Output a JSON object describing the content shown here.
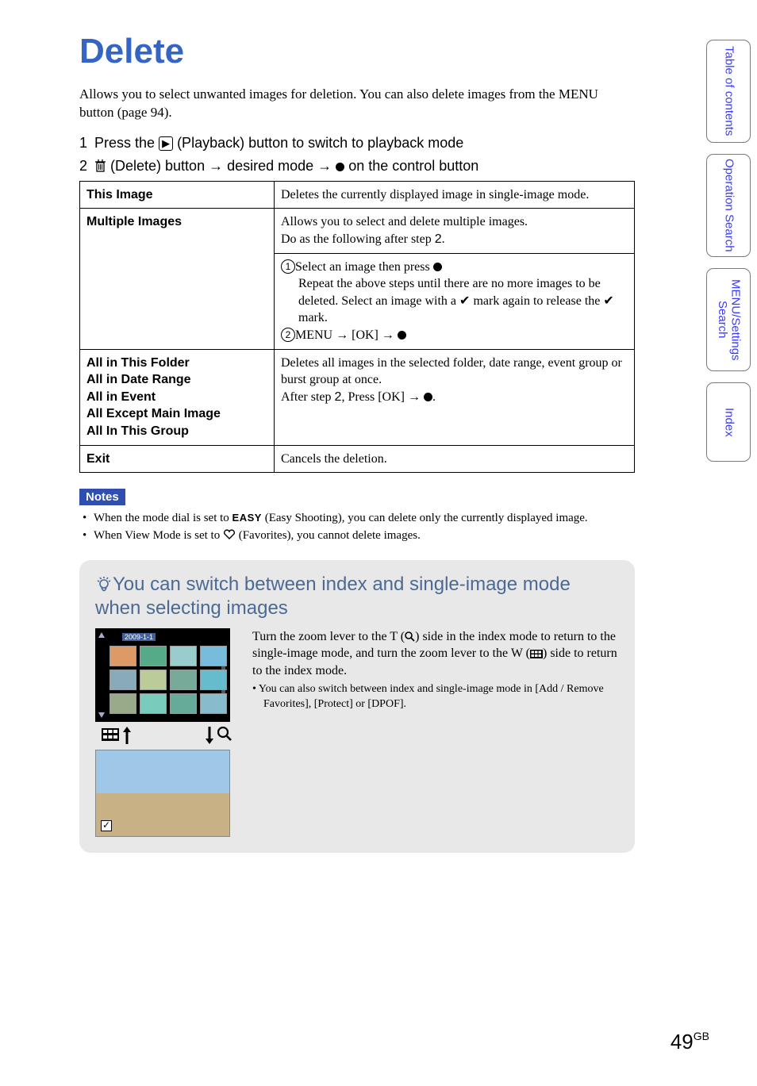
{
  "title": "Delete",
  "intro": "Allows you to select unwanted images for deletion. You can also delete images from the MENU button (page 94).",
  "step1": {
    "num": "1",
    "prefix": "Press the ",
    "suffix": " (Playback) button to switch to playback mode"
  },
  "step2": {
    "num": "2",
    "a": " (Delete) button ",
    "b": " desired mode ",
    "c": " on the control button"
  },
  "table": {
    "r1k": "This Image",
    "r1v": "Deletes the currently displayed image in single-image mode.",
    "r2k": "Multiple Images",
    "r2va": "Allows you to select and delete multiple images.",
    "r2vb_prefix": "Do as the following after step ",
    "r2vb_step": "2",
    "r2vb_suffix": ".",
    "r2s1a": "Select an image then press ",
    "r2s1b": "Repeat the above steps until there are no more images to be deleted. Select an image with a ",
    "r2s1c": " mark again to release the ",
    "r2s1d": " mark.",
    "r2s2a": "MENU ",
    "r2s2b": " [OK] ",
    "r3k1": "All in This Folder",
    "r3k2": "All in Date Range",
    "r3k3": "All in Event",
    "r3k4": "All Except Main Image",
    "r3k5": "All In This Group",
    "r3va": "Deletes all images in the selected folder, date range, event group or burst group at once.",
    "r3vb_prefix": "After step ",
    "r3vb_step": "2",
    "r3vb_mid": ", Press [OK] ",
    "r4k": "Exit",
    "r4v": "Cancels the deletion."
  },
  "notes": {
    "badge": "Notes",
    "n1a": "When the mode dial is set to ",
    "n1b": " (Easy Shooting), you can delete only the currently displayed image.",
    "n2a": "When View Mode is set to ",
    "n2b": " (Favorites), you cannot delete images."
  },
  "tip": {
    "title": "You can switch between index and single-image mode when selecting images",
    "p1a": "Turn the zoom lever to the T (",
    "p1b": ") side in the index mode to return to the single-image mode, and turn the zoom lever to the W (",
    "p1c": ") side to return to the index mode.",
    "p2": "You can also switch between index and single-image mode in [Add / Remove Favorites], [Protect] or [DPOF].",
    "date": "2009-1-1"
  },
  "tabs": {
    "t1": "Table of contents",
    "t2": "Operation Search",
    "t3": "MENU/Settings Search",
    "t4": "Index"
  },
  "page": {
    "num": "49",
    "suffix": "GB"
  },
  "icons": {
    "playback": "▶",
    "delete": "🗑",
    "right_arrow": "→",
    "dot": "●",
    "check": "✔",
    "magnify": "🔍",
    "heart": "♡",
    "easy": "EASY"
  }
}
